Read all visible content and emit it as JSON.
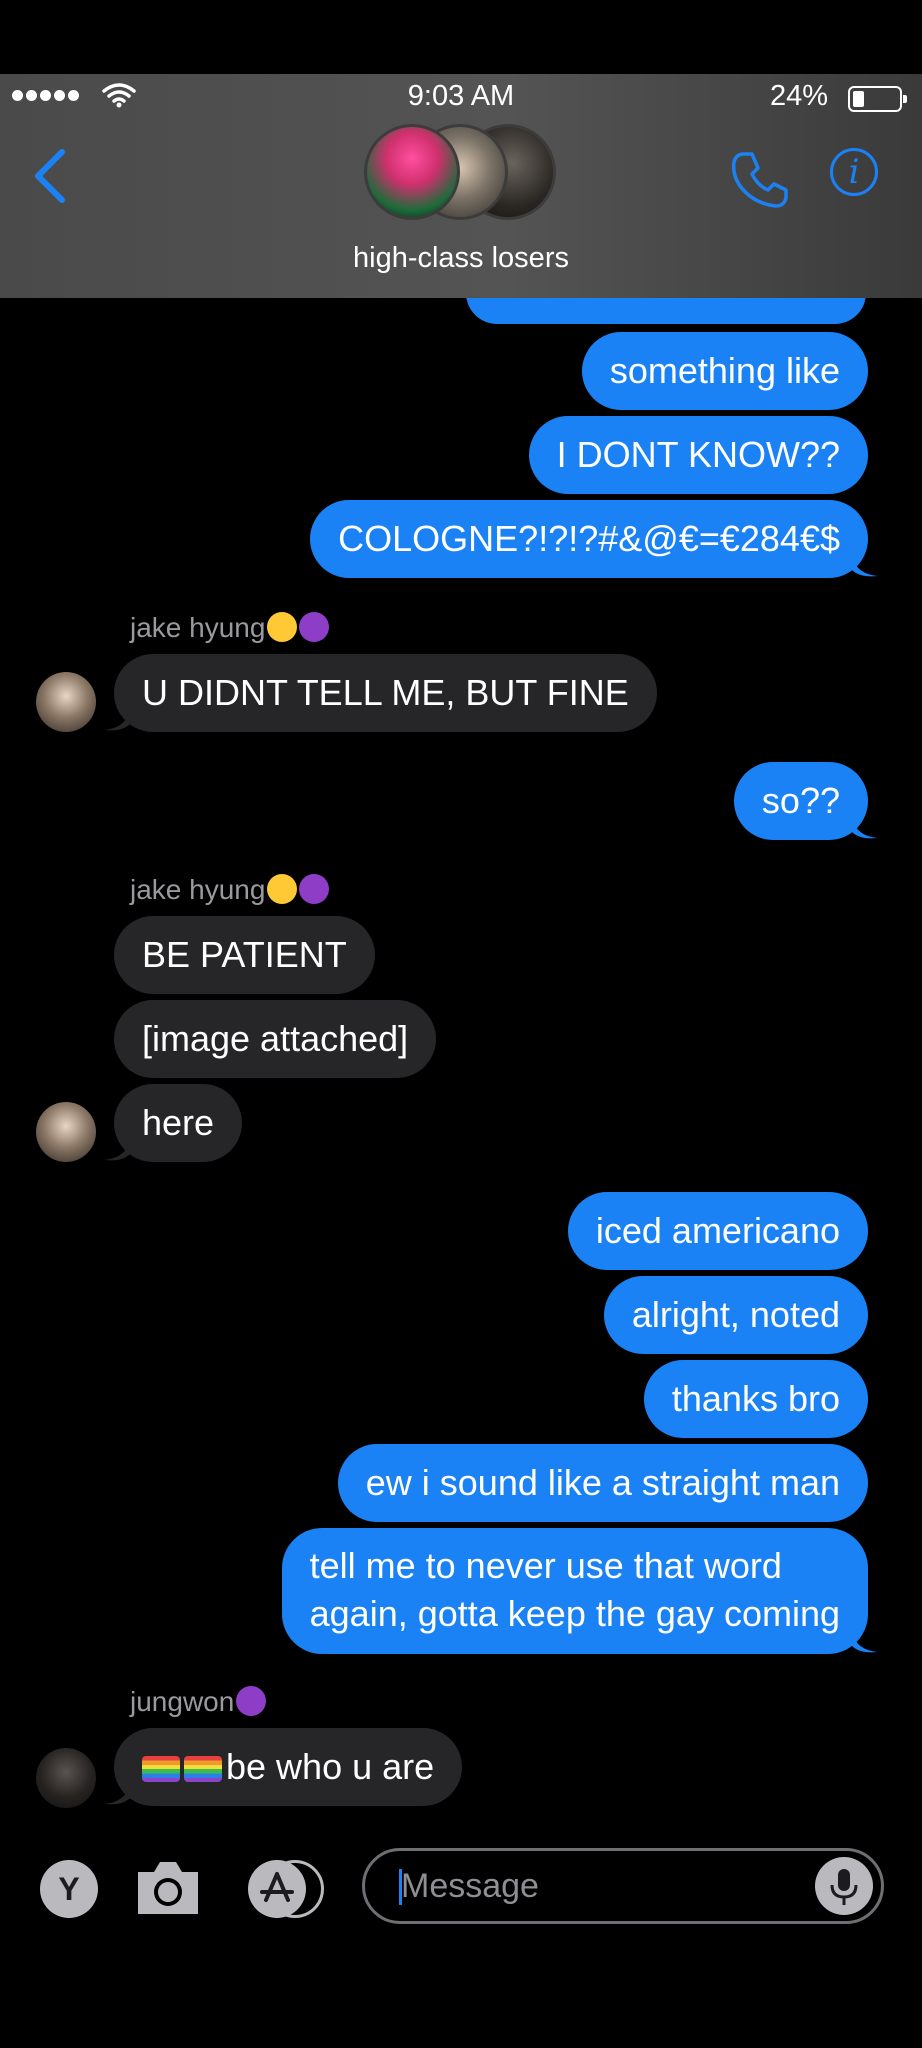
{
  "status_bar": {
    "time": "9:03 AM",
    "battery_percent": "24%",
    "battery_level": 0.24,
    "signal_bars": 5
  },
  "header": {
    "group_name": "high-class losers",
    "back_icon": "chevron-left-icon",
    "call_icon": "phone-icon",
    "info_icon": "info-icon"
  },
  "messages": [
    {
      "dir": "out",
      "text": "something like"
    },
    {
      "dir": "out",
      "text": "I DONT KNOW??"
    },
    {
      "dir": "out",
      "text": "COLOGNE?!?!?#&@€=€284€$"
    },
    {
      "dir": "in",
      "sender": "jake hyung",
      "text": "U DIDNT TELL ME, BUT FINE"
    },
    {
      "dir": "out",
      "text": "so??"
    },
    {
      "dir": "in",
      "sender": "jake hyung",
      "text": "BE PATIENT"
    },
    {
      "dir": "in",
      "text": "[image attached]"
    },
    {
      "dir": "in",
      "text": "here"
    },
    {
      "dir": "out",
      "text": "iced americano"
    },
    {
      "dir": "out",
      "text": "alright, noted"
    },
    {
      "dir": "out",
      "text": "thanks bro"
    },
    {
      "dir": "out",
      "text": "ew i sound like a straight man"
    },
    {
      "dir": "out",
      "text": "tell me to never use that word",
      "text2": "again, gotta keep the gay coming"
    },
    {
      "dir": "in",
      "sender": "jungwon",
      "text": "be who u are"
    }
  ],
  "composer": {
    "placeholder": "Message",
    "y_app_label": "Y"
  },
  "colors": {
    "outgoing": "#1b82f5",
    "incoming": "#262628",
    "background": "#000000",
    "accent": "#1b82f5"
  }
}
